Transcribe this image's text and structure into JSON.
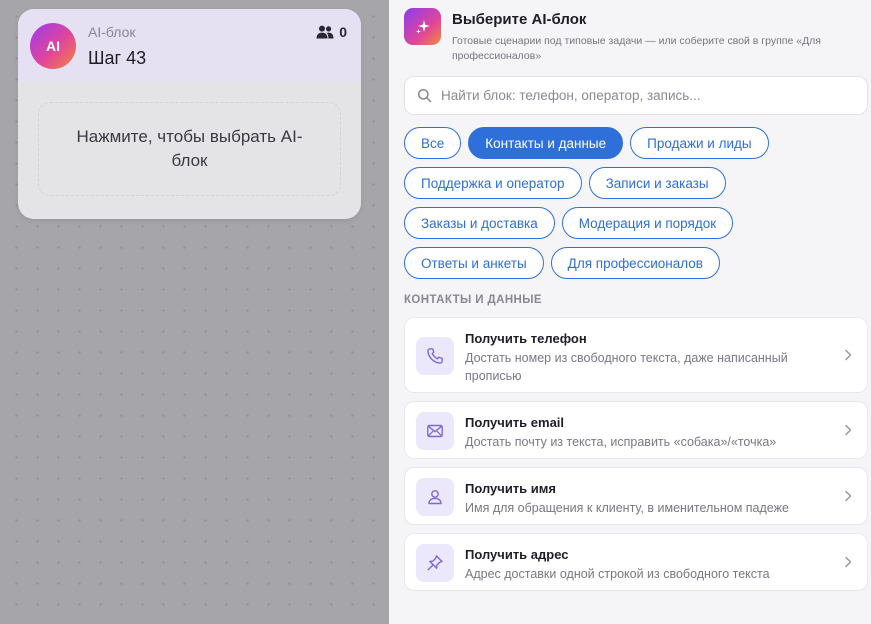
{
  "node": {
    "avatar": "AI",
    "type": "AI-блок",
    "title": "Шаг 43",
    "users_count": "0",
    "placeholder": "Нажмите, чтобы выбрать AI-блок"
  },
  "panel": {
    "title": "Выберите AI-блок",
    "subtitle": "Готовые сценарии под типовые задачи — или соберите свой в группе «Для профессионалов»"
  },
  "search": {
    "placeholder": "Найти блок: телефон, оператор, запись..."
  },
  "categories": [
    {
      "label": "Все",
      "active": false
    },
    {
      "label": "Контакты и данные",
      "active": true
    },
    {
      "label": "Продажи и лиды",
      "active": false
    },
    {
      "label": "Поддержка и оператор",
      "active": false
    },
    {
      "label": "Записи и заказы",
      "active": false
    },
    {
      "label": "Заказы и доставка",
      "active": false
    },
    {
      "label": "Модерация и порядок",
      "active": false
    },
    {
      "label": "Ответы и анкеты",
      "active": false
    },
    {
      "label": "Для профессионалов",
      "active": false
    }
  ],
  "section_label": "КОНТАКТЫ И ДАННЫЕ",
  "blocks": [
    {
      "icon": "phone-icon",
      "title": "Получить телефон",
      "description": "Достать номер из свободного текста, даже написанный прописью"
    },
    {
      "icon": "mail-icon",
      "title": "Получить email",
      "description": "Достать почту из текста, исправить «собака»/«точка»"
    },
    {
      "icon": "user-icon",
      "title": "Получить имя",
      "description": "Имя для обращения к клиенту, в именительном падеже"
    },
    {
      "icon": "pin-icon",
      "title": "Получить адрес",
      "description": "Адрес доставки одной строкой из свободного текста"
    }
  ],
  "colors": {
    "accent": "#2f6fd9",
    "icon_tint": "#7a6bd6",
    "node_header": "#e6e0f3"
  }
}
